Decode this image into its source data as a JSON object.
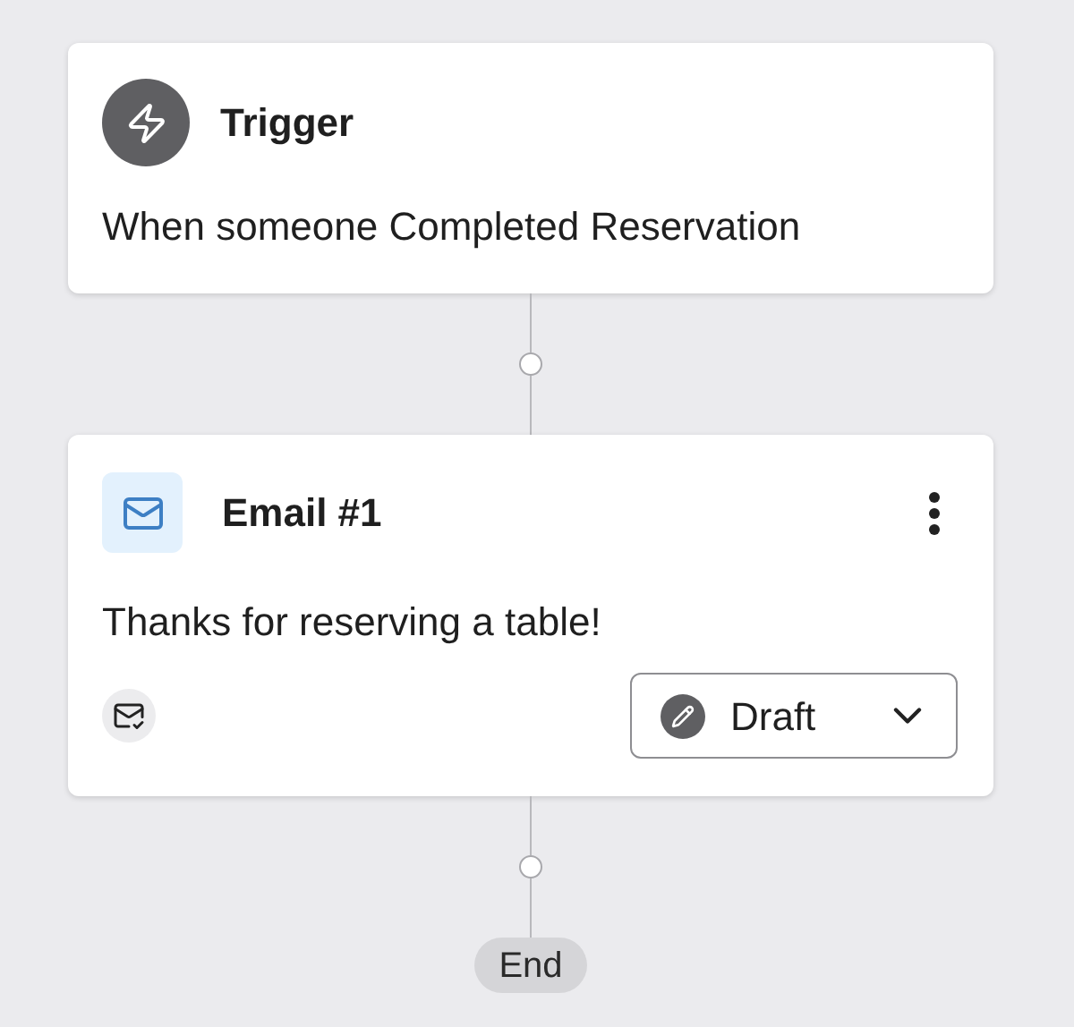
{
  "trigger": {
    "title": "Trigger",
    "description": "When someone Completed Reservation"
  },
  "email": {
    "title": "Email #1",
    "description": "Thanks for reserving a table!",
    "status": "Draft"
  },
  "end": {
    "label": "End"
  }
}
